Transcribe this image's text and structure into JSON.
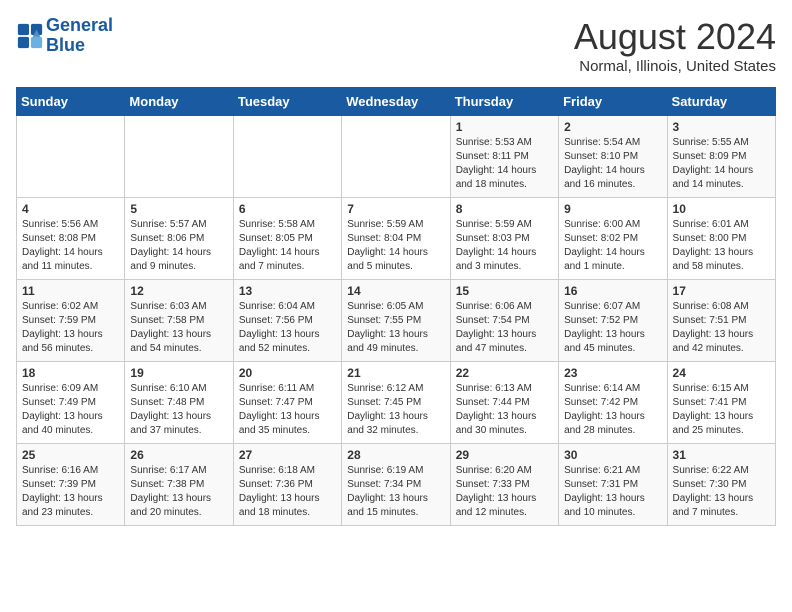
{
  "logo": {
    "line1": "General",
    "line2": "Blue"
  },
  "title": "August 2024",
  "subtitle": "Normal, Illinois, United States",
  "headers": [
    "Sunday",
    "Monday",
    "Tuesday",
    "Wednesday",
    "Thursday",
    "Friday",
    "Saturday"
  ],
  "weeks": [
    [
      {
        "day": "",
        "info": ""
      },
      {
        "day": "",
        "info": ""
      },
      {
        "day": "",
        "info": ""
      },
      {
        "day": "",
        "info": ""
      },
      {
        "day": "1",
        "info": "Sunrise: 5:53 AM\nSunset: 8:11 PM\nDaylight: 14 hours\nand 18 minutes."
      },
      {
        "day": "2",
        "info": "Sunrise: 5:54 AM\nSunset: 8:10 PM\nDaylight: 14 hours\nand 16 minutes."
      },
      {
        "day": "3",
        "info": "Sunrise: 5:55 AM\nSunset: 8:09 PM\nDaylight: 14 hours\nand 14 minutes."
      }
    ],
    [
      {
        "day": "4",
        "info": "Sunrise: 5:56 AM\nSunset: 8:08 PM\nDaylight: 14 hours\nand 11 minutes."
      },
      {
        "day": "5",
        "info": "Sunrise: 5:57 AM\nSunset: 8:06 PM\nDaylight: 14 hours\nand 9 minutes."
      },
      {
        "day": "6",
        "info": "Sunrise: 5:58 AM\nSunset: 8:05 PM\nDaylight: 14 hours\nand 7 minutes."
      },
      {
        "day": "7",
        "info": "Sunrise: 5:59 AM\nSunset: 8:04 PM\nDaylight: 14 hours\nand 5 minutes."
      },
      {
        "day": "8",
        "info": "Sunrise: 5:59 AM\nSunset: 8:03 PM\nDaylight: 14 hours\nand 3 minutes."
      },
      {
        "day": "9",
        "info": "Sunrise: 6:00 AM\nSunset: 8:02 PM\nDaylight: 14 hours\nand 1 minute."
      },
      {
        "day": "10",
        "info": "Sunrise: 6:01 AM\nSunset: 8:00 PM\nDaylight: 13 hours\nand 58 minutes."
      }
    ],
    [
      {
        "day": "11",
        "info": "Sunrise: 6:02 AM\nSunset: 7:59 PM\nDaylight: 13 hours\nand 56 minutes."
      },
      {
        "day": "12",
        "info": "Sunrise: 6:03 AM\nSunset: 7:58 PM\nDaylight: 13 hours\nand 54 minutes."
      },
      {
        "day": "13",
        "info": "Sunrise: 6:04 AM\nSunset: 7:56 PM\nDaylight: 13 hours\nand 52 minutes."
      },
      {
        "day": "14",
        "info": "Sunrise: 6:05 AM\nSunset: 7:55 PM\nDaylight: 13 hours\nand 49 minutes."
      },
      {
        "day": "15",
        "info": "Sunrise: 6:06 AM\nSunset: 7:54 PM\nDaylight: 13 hours\nand 47 minutes."
      },
      {
        "day": "16",
        "info": "Sunrise: 6:07 AM\nSunset: 7:52 PM\nDaylight: 13 hours\nand 45 minutes."
      },
      {
        "day": "17",
        "info": "Sunrise: 6:08 AM\nSunset: 7:51 PM\nDaylight: 13 hours\nand 42 minutes."
      }
    ],
    [
      {
        "day": "18",
        "info": "Sunrise: 6:09 AM\nSunset: 7:49 PM\nDaylight: 13 hours\nand 40 minutes."
      },
      {
        "day": "19",
        "info": "Sunrise: 6:10 AM\nSunset: 7:48 PM\nDaylight: 13 hours\nand 37 minutes."
      },
      {
        "day": "20",
        "info": "Sunrise: 6:11 AM\nSunset: 7:47 PM\nDaylight: 13 hours\nand 35 minutes."
      },
      {
        "day": "21",
        "info": "Sunrise: 6:12 AM\nSunset: 7:45 PM\nDaylight: 13 hours\nand 32 minutes."
      },
      {
        "day": "22",
        "info": "Sunrise: 6:13 AM\nSunset: 7:44 PM\nDaylight: 13 hours\nand 30 minutes."
      },
      {
        "day": "23",
        "info": "Sunrise: 6:14 AM\nSunset: 7:42 PM\nDaylight: 13 hours\nand 28 minutes."
      },
      {
        "day": "24",
        "info": "Sunrise: 6:15 AM\nSunset: 7:41 PM\nDaylight: 13 hours\nand 25 minutes."
      }
    ],
    [
      {
        "day": "25",
        "info": "Sunrise: 6:16 AM\nSunset: 7:39 PM\nDaylight: 13 hours\nand 23 minutes."
      },
      {
        "day": "26",
        "info": "Sunrise: 6:17 AM\nSunset: 7:38 PM\nDaylight: 13 hours\nand 20 minutes."
      },
      {
        "day": "27",
        "info": "Sunrise: 6:18 AM\nSunset: 7:36 PM\nDaylight: 13 hours\nand 18 minutes."
      },
      {
        "day": "28",
        "info": "Sunrise: 6:19 AM\nSunset: 7:34 PM\nDaylight: 13 hours\nand 15 minutes."
      },
      {
        "day": "29",
        "info": "Sunrise: 6:20 AM\nSunset: 7:33 PM\nDaylight: 13 hours\nand 12 minutes."
      },
      {
        "day": "30",
        "info": "Sunrise: 6:21 AM\nSunset: 7:31 PM\nDaylight: 13 hours\nand 10 minutes."
      },
      {
        "day": "31",
        "info": "Sunrise: 6:22 AM\nSunset: 7:30 PM\nDaylight: 13 hours\nand 7 minutes."
      }
    ]
  ]
}
